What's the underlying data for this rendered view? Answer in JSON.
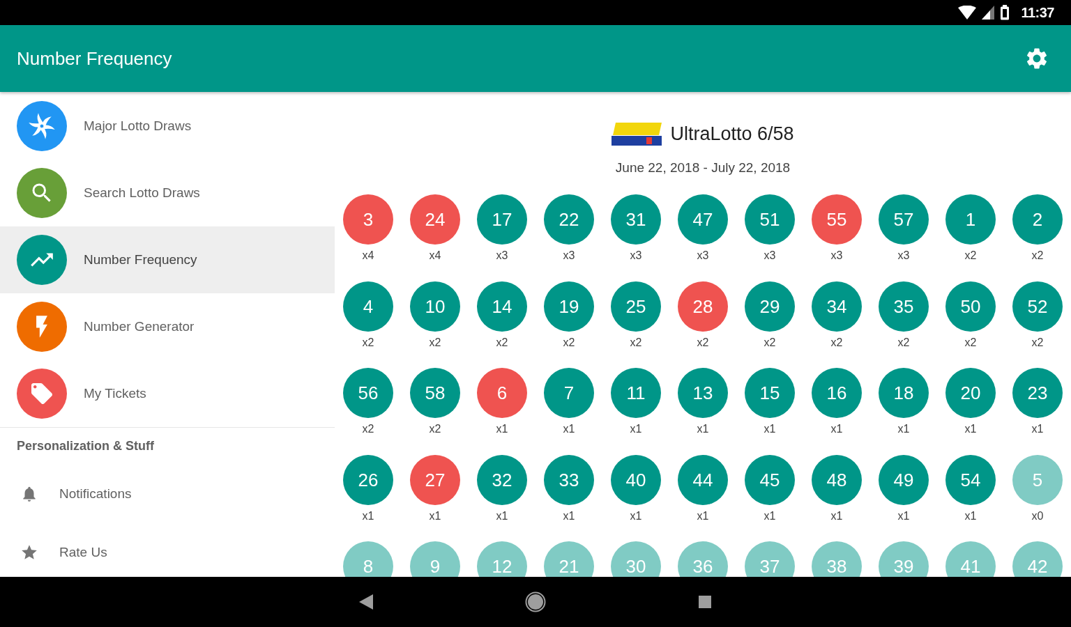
{
  "status_bar": {
    "time": "11:37"
  },
  "app_bar": {
    "title": "Number Frequency"
  },
  "drawer": {
    "items": [
      {
        "label": "Major Lotto Draws",
        "kind": "swirl",
        "color": "#2196f3",
        "selected": false
      },
      {
        "label": "Search Lotto Draws",
        "kind": "search",
        "color": "#689f38",
        "selected": false
      },
      {
        "label": "Number Frequency",
        "kind": "trend",
        "color": "#009688",
        "selected": true
      },
      {
        "label": "Number Generator",
        "kind": "bolt",
        "color": "#ef6c00",
        "selected": false
      },
      {
        "label": "My Tickets",
        "kind": "tag",
        "color": "#ef5350",
        "selected": false
      }
    ],
    "section_title": "Personalization & Stuff",
    "settings_items": [
      {
        "label": "Notifications",
        "kind": "bell"
      },
      {
        "label": "Rate Us",
        "kind": "star"
      }
    ]
  },
  "game": {
    "name": "UltraLotto 6/58",
    "date_range": "June 22, 2018 - July 22, 2018"
  },
  "numbers": [
    {
      "number": "3",
      "count": "x4",
      "color": "#ef5350"
    },
    {
      "number": "24",
      "count": "x4",
      "color": "#ef5350"
    },
    {
      "number": "17",
      "count": "x3",
      "color": "#009688"
    },
    {
      "number": "22",
      "count": "x3",
      "color": "#009688"
    },
    {
      "number": "31",
      "count": "x3",
      "color": "#009688"
    },
    {
      "number": "47",
      "count": "x3",
      "color": "#009688"
    },
    {
      "number": "51",
      "count": "x3",
      "color": "#009688"
    },
    {
      "number": "55",
      "count": "x3",
      "color": "#ef5350"
    },
    {
      "number": "57",
      "count": "x3",
      "color": "#009688"
    },
    {
      "number": "1",
      "count": "x2",
      "color": "#009688"
    },
    {
      "number": "2",
      "count": "x2",
      "color": "#009688"
    },
    {
      "number": "4",
      "count": "x2",
      "color": "#009688"
    },
    {
      "number": "10",
      "count": "x2",
      "color": "#009688"
    },
    {
      "number": "14",
      "count": "x2",
      "color": "#009688"
    },
    {
      "number": "19",
      "count": "x2",
      "color": "#009688"
    },
    {
      "number": "25",
      "count": "x2",
      "color": "#009688"
    },
    {
      "number": "28",
      "count": "x2",
      "color": "#ef5350"
    },
    {
      "number": "29",
      "count": "x2",
      "color": "#009688"
    },
    {
      "number": "34",
      "count": "x2",
      "color": "#009688"
    },
    {
      "number": "35",
      "count": "x2",
      "color": "#009688"
    },
    {
      "number": "50",
      "count": "x2",
      "color": "#009688"
    },
    {
      "number": "52",
      "count": "x2",
      "color": "#009688"
    },
    {
      "number": "56",
      "count": "x2",
      "color": "#009688"
    },
    {
      "number": "58",
      "count": "x2",
      "color": "#009688"
    },
    {
      "number": "6",
      "count": "x1",
      "color": "#ef5350"
    },
    {
      "number": "7",
      "count": "x1",
      "color": "#009688"
    },
    {
      "number": "11",
      "count": "x1",
      "color": "#009688"
    },
    {
      "number": "13",
      "count": "x1",
      "color": "#009688"
    },
    {
      "number": "15",
      "count": "x1",
      "color": "#009688"
    },
    {
      "number": "16",
      "count": "x1",
      "color": "#009688"
    },
    {
      "number": "18",
      "count": "x1",
      "color": "#009688"
    },
    {
      "number": "20",
      "count": "x1",
      "color": "#009688"
    },
    {
      "number": "23",
      "count": "x1",
      "color": "#009688"
    },
    {
      "number": "26",
      "count": "x1",
      "color": "#009688"
    },
    {
      "number": "27",
      "count": "x1",
      "color": "#ef5350"
    },
    {
      "number": "32",
      "count": "x1",
      "color": "#009688"
    },
    {
      "number": "33",
      "count": "x1",
      "color": "#009688"
    },
    {
      "number": "40",
      "count": "x1",
      "color": "#009688"
    },
    {
      "number": "44",
      "count": "x1",
      "color": "#009688"
    },
    {
      "number": "45",
      "count": "x1",
      "color": "#009688"
    },
    {
      "number": "48",
      "count": "x1",
      "color": "#009688"
    },
    {
      "number": "49",
      "count": "x1",
      "color": "#009688"
    },
    {
      "number": "54",
      "count": "x1",
      "color": "#009688"
    },
    {
      "number": "5",
      "count": "x0",
      "color": "#80cbc4"
    },
    {
      "number": "8",
      "color": "#80cbc4"
    },
    {
      "number": "9",
      "color": "#80cbc4"
    },
    {
      "number": "12",
      "color": "#80cbc4"
    },
    {
      "number": "21",
      "color": "#80cbc4"
    },
    {
      "number": "30",
      "color": "#80cbc4"
    },
    {
      "number": "36",
      "color": "#80cbc4"
    },
    {
      "number": "37",
      "color": "#80cbc4"
    },
    {
      "number": "38",
      "color": "#80cbc4"
    },
    {
      "number": "39",
      "color": "#80cbc4"
    },
    {
      "number": "41",
      "color": "#80cbc4"
    },
    {
      "number": "42",
      "color": "#80cbc4"
    }
  ]
}
